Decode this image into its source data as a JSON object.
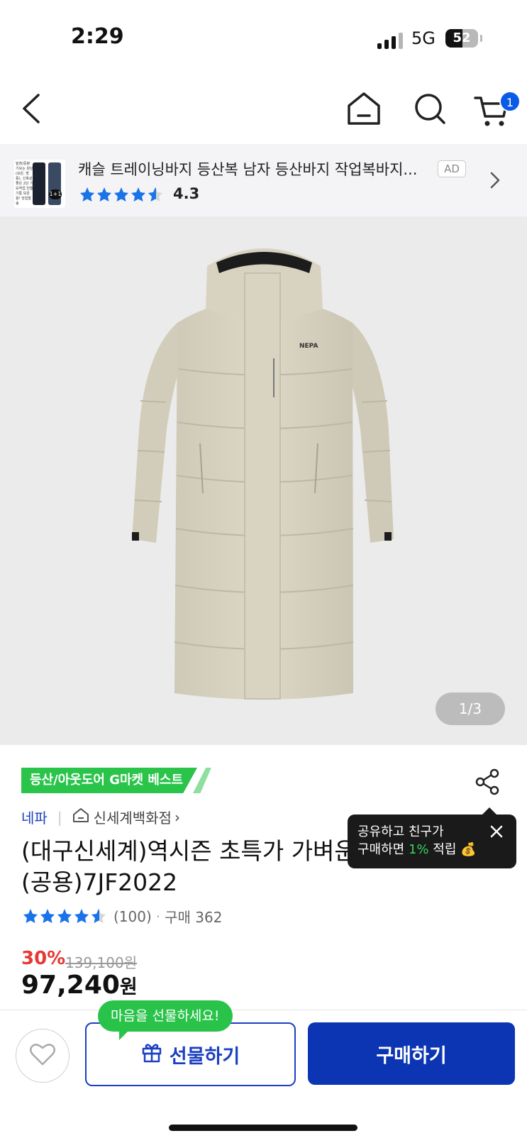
{
  "status_bar": {
    "time": "2:29",
    "network": "5G",
    "battery": "52",
    "battery_level": 0.52
  },
  "nav": {
    "cart_count": "1"
  },
  "ad": {
    "title": "캐슬 트레이닝바지 등산복 남자 등산바지 작업복바지...",
    "label": "AD",
    "rating": "4.3",
    "thumb_text": "밑창/중량 기모는 원단(보온, 방풍), 신축성 좋은 2단 기모작업 전철기통 보온용! 당일발송",
    "thumb_badge": "1+1"
  },
  "hero": {
    "pager_current": "1",
    "pager_total": "/3",
    "logo_text": "NEPA"
  },
  "product": {
    "best_badge": "등산/아웃도어 G마켓 베스트",
    "brand": "네파",
    "store": "신세계백화점",
    "store_chevron": "›",
    "title": "(대구신세계)역시즌 초특가 가벼운 롱 다운 자켓 (공용)7JF2022",
    "review_count": "(100)",
    "purchase": "구매 362",
    "dot": "·",
    "discount": "30%",
    "original_price": "139,100원",
    "price": "97,240",
    "price_unit": "원"
  },
  "tooltip": {
    "line1": "공유하고 친구가",
    "line2_a": "구매하면 ",
    "line2_pct": "1%",
    "line2_b": " 적립 💰"
  },
  "bottom": {
    "gift_bubble": "마음을 선물하세요!",
    "gift_label": "선물하기",
    "buy_label": "구매하기"
  },
  "colors": {
    "brand_blue": "#0b35b3",
    "green": "#29c34a",
    "red": "#e53935",
    "star_blue": "#1a73e8"
  }
}
